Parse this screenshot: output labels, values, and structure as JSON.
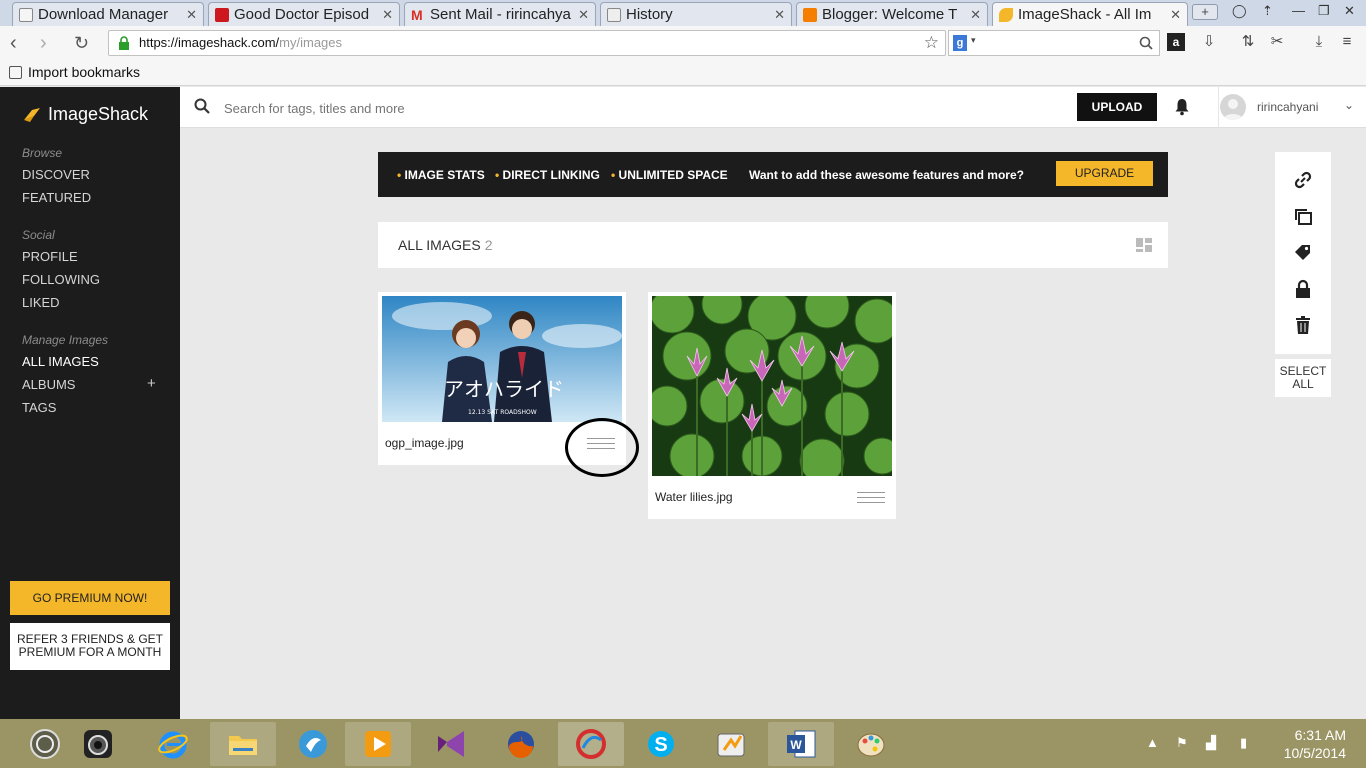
{
  "browser": {
    "tabs": [
      {
        "label": "Download Manager",
        "fav_color": "#8a8a8a"
      },
      {
        "label": "Good Doctor Episod",
        "fav_color": "#cc181e"
      },
      {
        "label": "Sent Mail - ririncahya",
        "fav_color": "#d93025"
      },
      {
        "label": "History",
        "fav_color": "#9a9a9a"
      },
      {
        "label": "Blogger: Welcome T",
        "fav_color": "#f57d00"
      },
      {
        "label": "ImageShack - All Im",
        "fav_color": "#f5b72a"
      }
    ],
    "new_tab": "+",
    "url_host": "https://imageshack.com/",
    "url_path": "my/images",
    "search_engine_badge": "g",
    "bookmark": "Import bookmarks"
  },
  "site": {
    "logo": "ImageShack",
    "search_placeholder": "Search for tags, titles and more",
    "upload": "UPLOAD",
    "username": "ririncahyani"
  },
  "sidebar": {
    "sections": [
      {
        "title": "Browse",
        "items": [
          "DISCOVER",
          "FEATURED"
        ]
      },
      {
        "title": "Social",
        "items": [
          "PROFILE",
          "FOLLOWING",
          "LIKED"
        ]
      },
      {
        "title": "Manage Images",
        "items": [
          "ALL IMAGES",
          "ALBUMS",
          "TAGS"
        ]
      }
    ],
    "albums_add": "+",
    "premium": "GO PREMIUM NOW!",
    "refer_line1": "REFER 3 FRIENDS & GET",
    "refer_line2": "PREMIUM FOR A MONTH"
  },
  "banner": {
    "features": [
      "IMAGE STATS",
      "DIRECT LINKING",
      "UNLIMITED SPACE"
    ],
    "cta": "Want to add these awesome features and more?",
    "upgrade": "UPGRADE"
  },
  "gallery": {
    "title": "ALL IMAGES",
    "count": "2",
    "images": [
      {
        "name": "ogp_image.jpg",
        "poster_text": "アオハライド",
        "poster_date": "12.13 SAT ROADSHOW"
      },
      {
        "name": "Water lilies.jpg"
      }
    ]
  },
  "tools": {
    "icons": [
      "link-icon",
      "copy-icon",
      "tag-icon",
      "lock-icon",
      "trash-icon"
    ],
    "select_all_line1": "SELECT",
    "select_all_line2": "ALL"
  },
  "taskbar": {
    "apps": [
      "camera-app",
      "internet-explorer",
      "file-explorer",
      "messenger-app",
      "media-player",
      "visual-studio",
      "firefox",
      "opera",
      "skype",
      "utility-app",
      "word",
      "paint"
    ],
    "time": "6:31 AM",
    "date": "10/5/2014"
  },
  "colors": {
    "accent": "#f5b72a",
    "sidebar_bg": "#1c1c1c",
    "taskbar_bg": "#9b9565"
  }
}
